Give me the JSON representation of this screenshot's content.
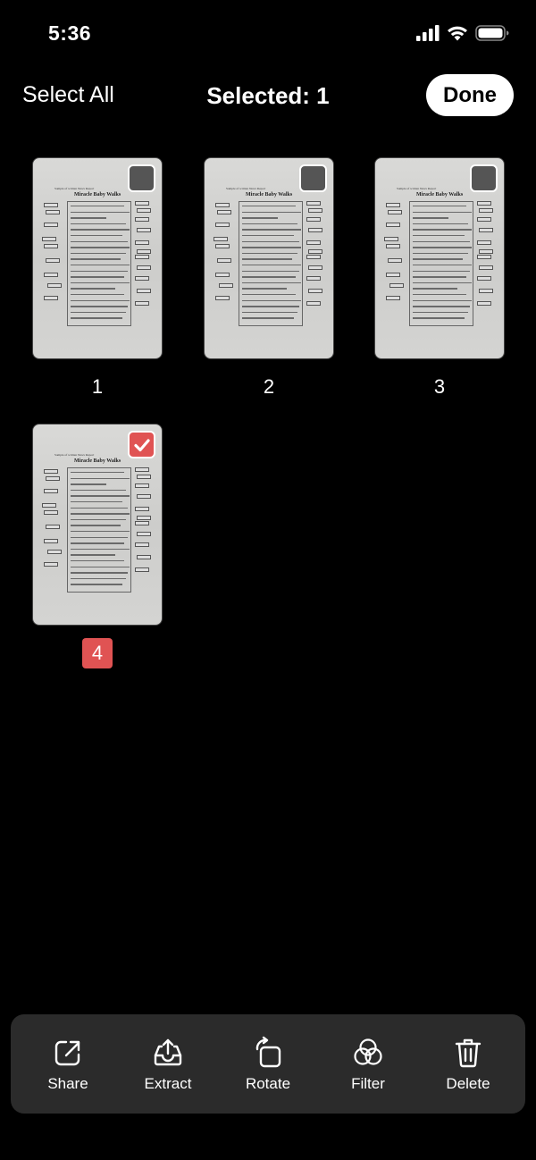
{
  "status_bar": {
    "time": "5:36",
    "icons": [
      "cellular-signal-icon",
      "wifi-icon",
      "battery-icon"
    ]
  },
  "nav": {
    "select_all_label": "Select All",
    "title": "Selected: 1",
    "done_label": "Done"
  },
  "pages": [
    {
      "number": "1",
      "selected": false,
      "doc_header": "Sample of written News Report",
      "doc_title": "Miracle Baby Walks"
    },
    {
      "number": "2",
      "selected": false,
      "doc_header": "Sample of written News Report",
      "doc_title": "Miracle Baby Walks"
    },
    {
      "number": "3",
      "selected": false,
      "doc_header": "Sample of written News Report",
      "doc_title": "Miracle Baby Walks"
    },
    {
      "number": "4",
      "selected": true,
      "doc_header": "Sample of written News Report",
      "doc_title": "Miracle Baby Walks"
    }
  ],
  "toolbar": {
    "items": [
      {
        "label": "Share",
        "icon": "share-icon"
      },
      {
        "label": "Extract",
        "icon": "extract-icon"
      },
      {
        "label": "Rotate",
        "icon": "rotate-icon"
      },
      {
        "label": "Filter",
        "icon": "filter-icon"
      },
      {
        "label": "Delete",
        "icon": "trash-icon"
      }
    ]
  },
  "colors": {
    "accent_selected": "#e05353",
    "toolbar_bg": "#2b2b2b",
    "background": "#000000"
  }
}
